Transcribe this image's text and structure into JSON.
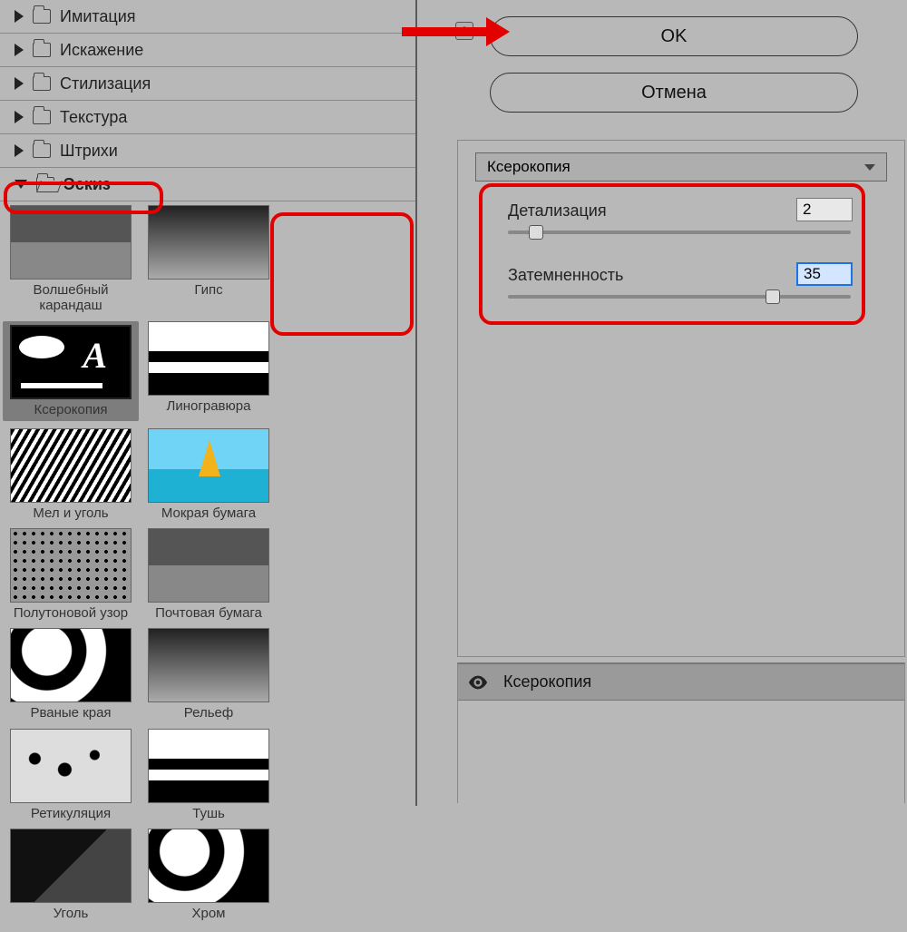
{
  "categories": [
    {
      "label": "Имитация",
      "expanded": false
    },
    {
      "label": "Искажение",
      "expanded": false
    },
    {
      "label": "Стилизация",
      "expanded": false
    },
    {
      "label": "Текстура",
      "expanded": false
    },
    {
      "label": "Штрихи",
      "expanded": false
    },
    {
      "label": "Эскиз",
      "expanded": true
    }
  ],
  "gallery": [
    {
      "label": "Волшебный карандаш",
      "selected": false
    },
    {
      "label": "Гипс",
      "selected": false
    },
    {
      "label": "Ксерокопия",
      "selected": true
    },
    {
      "label": "Линогравюра",
      "selected": false
    },
    {
      "label": "Мел и уголь",
      "selected": false
    },
    {
      "label": "Мокрая бумага",
      "selected": false
    },
    {
      "label": "Полутоновой узор",
      "selected": false
    },
    {
      "label": "Почтовая бумага",
      "selected": false
    },
    {
      "label": "Рваные края",
      "selected": false
    },
    {
      "label": "Рельеф",
      "selected": false
    },
    {
      "label": "Ретикуляция",
      "selected": false
    },
    {
      "label": "Тушь",
      "selected": false
    },
    {
      "label": "Уголь",
      "selected": false
    },
    {
      "label": "Хром",
      "selected": false
    }
  ],
  "buttons": {
    "ok": "OK",
    "cancel": "Отмена"
  },
  "filter_dropdown": {
    "selected": "Ксерокопия"
  },
  "params": {
    "detail": {
      "label": "Детализация",
      "value": "2",
      "pct": 6
    },
    "darkness": {
      "label": "Затемненность",
      "value": "35",
      "pct": 75
    }
  },
  "layers": {
    "row_label": "Ксерокопия"
  },
  "annotations": {
    "arrow_color": "#e20000",
    "highlight_color": "#e20000"
  }
}
